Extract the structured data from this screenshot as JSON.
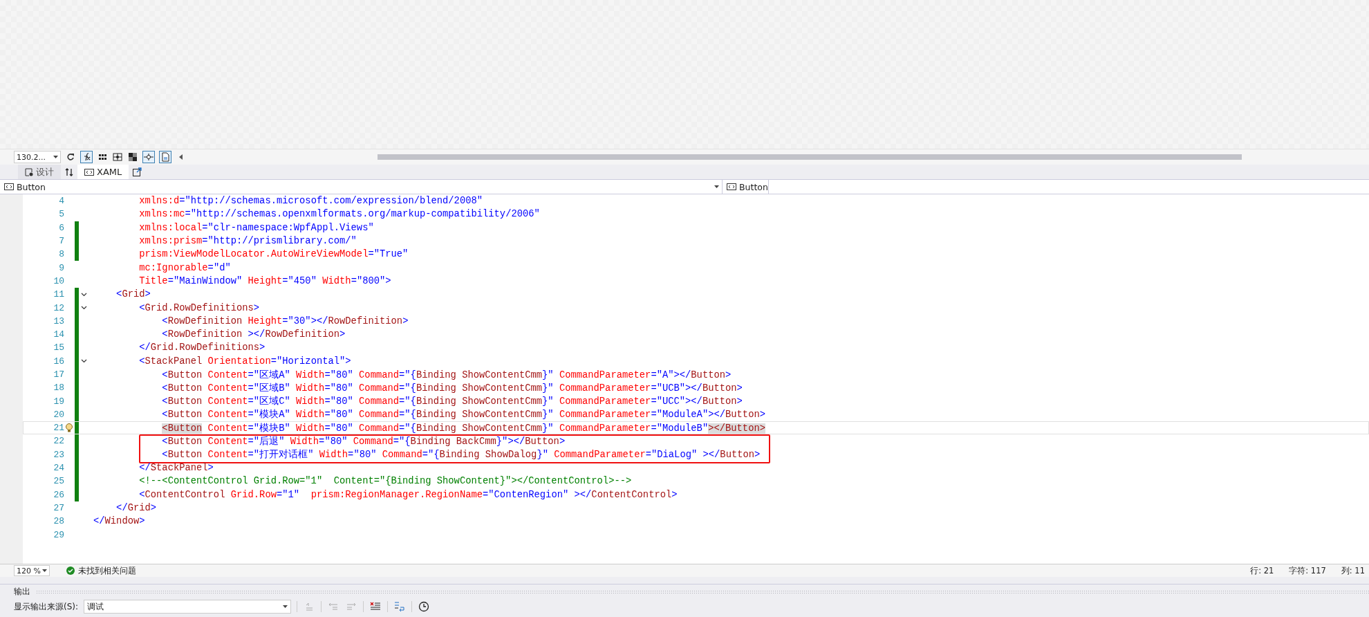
{
  "designer_toolbar": {
    "zoom": "130.2..."
  },
  "tabs": [
    {
      "label": "设计",
      "selected": false
    },
    {
      "label": "XAML",
      "selected": true
    }
  ],
  "nav_bar": {
    "left": "Button",
    "right": "Button"
  },
  "editor": {
    "lines": [
      {
        "number": "4",
        "changed": false,
        "foldable": false,
        "current": false,
        "boxed": false,
        "tokens": [
          {
            "kind": "attr",
            "text": "        xmlns:d"
          },
          {
            "kind": "punct",
            "text": "="
          },
          {
            "kind": "value",
            "text": "\"http://schemas.microsoft.com/expression/blend/2008\""
          }
        ]
      },
      {
        "number": "5",
        "changed": false,
        "foldable": false,
        "current": false,
        "boxed": false,
        "tokens": [
          {
            "kind": "attr",
            "text": "        xmlns:mc"
          },
          {
            "kind": "punct",
            "text": "="
          },
          {
            "kind": "value",
            "text": "\"http://schemas.openxmlformats.org/markup-compatibility/2006\""
          }
        ]
      },
      {
        "number": "6",
        "changed": true,
        "foldable": false,
        "current": false,
        "boxed": false,
        "tokens": [
          {
            "kind": "attr",
            "text": "        xmlns:local"
          },
          {
            "kind": "punct",
            "text": "="
          },
          {
            "kind": "value",
            "text": "\"clr-namespace:WpfAppl.Views\""
          }
        ]
      },
      {
        "number": "7",
        "changed": true,
        "foldable": false,
        "current": false,
        "boxed": false,
        "tokens": [
          {
            "kind": "attr",
            "text": "        xmlns:prism"
          },
          {
            "kind": "punct",
            "text": "="
          },
          {
            "kind": "value",
            "text": "\"http://prismlibrary.com/\""
          }
        ]
      },
      {
        "number": "8",
        "changed": true,
        "foldable": false,
        "current": false,
        "boxed": false,
        "tokens": [
          {
            "kind": "attr",
            "text": "        prism:ViewModelLocator.AutoWireViewModel"
          },
          {
            "kind": "punct",
            "text": "="
          },
          {
            "kind": "value",
            "text": "\"True\""
          }
        ]
      },
      {
        "number": "9",
        "changed": false,
        "foldable": false,
        "current": false,
        "boxed": false,
        "tokens": [
          {
            "kind": "attr",
            "text": "        mc:Ignorable"
          },
          {
            "kind": "punct",
            "text": "="
          },
          {
            "kind": "value",
            "text": "\"d\""
          }
        ]
      },
      {
        "number": "10",
        "changed": false,
        "foldable": false,
        "current": false,
        "boxed": false,
        "tokens": [
          {
            "kind": "attr",
            "text": "        Title"
          },
          {
            "kind": "punct",
            "text": "="
          },
          {
            "kind": "value",
            "text": "\"MainWindow\""
          },
          {
            "kind": "attr",
            "text": " Height"
          },
          {
            "kind": "punct",
            "text": "="
          },
          {
            "kind": "value",
            "text": "\"450\""
          },
          {
            "kind": "attr",
            "text": " Width"
          },
          {
            "kind": "punct",
            "text": "="
          },
          {
            "kind": "value",
            "text": "\"800\""
          },
          {
            "kind": "punct",
            "text": ">"
          }
        ]
      },
      {
        "number": "11",
        "changed": true,
        "foldable": true,
        "current": false,
        "boxed": false,
        "tokens": [
          {
            "kind": "punct",
            "text": "    <"
          },
          {
            "kind": "element",
            "text": "Grid"
          },
          {
            "kind": "punct",
            "text": ">"
          }
        ]
      },
      {
        "number": "12",
        "changed": true,
        "foldable": true,
        "current": false,
        "boxed": false,
        "tokens": [
          {
            "kind": "punct",
            "text": "        <"
          },
          {
            "kind": "element",
            "text": "Grid.RowDefinitions"
          },
          {
            "kind": "punct",
            "text": ">"
          }
        ]
      },
      {
        "number": "13",
        "changed": true,
        "foldable": false,
        "current": false,
        "boxed": false,
        "tokens": [
          {
            "kind": "punct",
            "text": "            <"
          },
          {
            "kind": "element",
            "text": "RowDefinition"
          },
          {
            "kind": "attr",
            "text": " Height"
          },
          {
            "kind": "punct",
            "text": "="
          },
          {
            "kind": "value",
            "text": "\"30\""
          },
          {
            "kind": "punct",
            "text": "></"
          },
          {
            "kind": "element",
            "text": "RowDefinition"
          },
          {
            "kind": "punct",
            "text": ">"
          }
        ]
      },
      {
        "number": "14",
        "changed": true,
        "foldable": false,
        "current": false,
        "boxed": false,
        "tokens": [
          {
            "kind": "punct",
            "text": "            <"
          },
          {
            "kind": "element",
            "text": "RowDefinition"
          },
          {
            "kind": "punct",
            "text": " ></"
          },
          {
            "kind": "element",
            "text": "RowDefinition"
          },
          {
            "kind": "punct",
            "text": ">"
          }
        ]
      },
      {
        "number": "15",
        "changed": true,
        "foldable": false,
        "current": false,
        "boxed": false,
        "tokens": [
          {
            "kind": "punct",
            "text": "        </"
          },
          {
            "kind": "element",
            "text": "Grid.RowDefinitions"
          },
          {
            "kind": "punct",
            "text": ">"
          }
        ]
      },
      {
        "number": "16",
        "changed": true,
        "foldable": true,
        "current": false,
        "boxed": false,
        "tokens": [
          {
            "kind": "punct",
            "text": "        <"
          },
          {
            "kind": "element",
            "text": "StackPanel"
          },
          {
            "kind": "attr",
            "text": " Orientation"
          },
          {
            "kind": "punct",
            "text": "="
          },
          {
            "kind": "value",
            "text": "\"Horizontal\""
          },
          {
            "kind": "punct",
            "text": ">"
          }
        ]
      },
      {
        "number": "17",
        "changed": true,
        "foldable": false,
        "current": false,
        "boxed": false,
        "tokens": [
          {
            "kind": "punct",
            "text": "            <"
          },
          {
            "kind": "element",
            "text": "Button"
          },
          {
            "kind": "attr",
            "text": " Content"
          },
          {
            "kind": "punct",
            "text": "="
          },
          {
            "kind": "value",
            "text": "\"区域A\""
          },
          {
            "kind": "attr",
            "text": " Width"
          },
          {
            "kind": "punct",
            "text": "="
          },
          {
            "kind": "value",
            "text": "\"80\""
          },
          {
            "kind": "attr",
            "text": " Command"
          },
          {
            "kind": "punct",
            "text": "="
          },
          {
            "kind": "value",
            "text": "\"{"
          },
          {
            "kind": "element",
            "text": "Binding ShowContentCmm"
          },
          {
            "kind": "value",
            "text": "}\""
          },
          {
            "kind": "attr",
            "text": " CommandParameter"
          },
          {
            "kind": "punct",
            "text": "="
          },
          {
            "kind": "value",
            "text": "\"A\""
          },
          {
            "kind": "punct",
            "text": "></"
          },
          {
            "kind": "element",
            "text": "Button"
          },
          {
            "kind": "punct",
            "text": ">"
          }
        ]
      },
      {
        "number": "18",
        "changed": true,
        "foldable": false,
        "current": false,
        "boxed": false,
        "tokens": [
          {
            "kind": "punct",
            "text": "            <"
          },
          {
            "kind": "element",
            "text": "Button"
          },
          {
            "kind": "attr",
            "text": " Content"
          },
          {
            "kind": "punct",
            "text": "="
          },
          {
            "kind": "value",
            "text": "\"区域B\""
          },
          {
            "kind": "attr",
            "text": " Width"
          },
          {
            "kind": "punct",
            "text": "="
          },
          {
            "kind": "value",
            "text": "\"80\""
          },
          {
            "kind": "attr",
            "text": " Command"
          },
          {
            "kind": "punct",
            "text": "="
          },
          {
            "kind": "value",
            "text": "\"{"
          },
          {
            "kind": "element",
            "text": "Binding ShowContentCmm"
          },
          {
            "kind": "value",
            "text": "}\""
          },
          {
            "kind": "attr",
            "text": " CommandParameter"
          },
          {
            "kind": "punct",
            "text": "="
          },
          {
            "kind": "value",
            "text": "\"UCB\""
          },
          {
            "kind": "punct",
            "text": "></"
          },
          {
            "kind": "element",
            "text": "Button"
          },
          {
            "kind": "punct",
            "text": ">"
          }
        ]
      },
      {
        "number": "19",
        "changed": true,
        "foldable": false,
        "current": false,
        "boxed": false,
        "tokens": [
          {
            "kind": "punct",
            "text": "            <"
          },
          {
            "kind": "element",
            "text": "Button"
          },
          {
            "kind": "attr",
            "text": " Content"
          },
          {
            "kind": "punct",
            "text": "="
          },
          {
            "kind": "value",
            "text": "\"区域C\""
          },
          {
            "kind": "attr",
            "text": " Width"
          },
          {
            "kind": "punct",
            "text": "="
          },
          {
            "kind": "value",
            "text": "\"80\""
          },
          {
            "kind": "attr",
            "text": " Command"
          },
          {
            "kind": "punct",
            "text": "="
          },
          {
            "kind": "value",
            "text": "\"{"
          },
          {
            "kind": "element",
            "text": "Binding ShowContentCmm"
          },
          {
            "kind": "value",
            "text": "}\""
          },
          {
            "kind": "attr",
            "text": " CommandParameter"
          },
          {
            "kind": "punct",
            "text": "="
          },
          {
            "kind": "value",
            "text": "\"UCC\""
          },
          {
            "kind": "punct",
            "text": "></"
          },
          {
            "kind": "element",
            "text": "Button"
          },
          {
            "kind": "punct",
            "text": ">"
          }
        ]
      },
      {
        "number": "20",
        "changed": true,
        "foldable": false,
        "current": false,
        "boxed": false,
        "tokens": [
          {
            "kind": "punct",
            "text": "            <"
          },
          {
            "kind": "element",
            "text": "Button"
          },
          {
            "kind": "attr",
            "text": " Content"
          },
          {
            "kind": "punct",
            "text": "="
          },
          {
            "kind": "value",
            "text": "\"模块A\""
          },
          {
            "kind": "attr",
            "text": " Width"
          },
          {
            "kind": "punct",
            "text": "="
          },
          {
            "kind": "value",
            "text": "\"80\""
          },
          {
            "kind": "attr",
            "text": " Command"
          },
          {
            "kind": "punct",
            "text": "="
          },
          {
            "kind": "value",
            "text": "\"{"
          },
          {
            "kind": "element",
            "text": "Binding ShowContentCmm"
          },
          {
            "kind": "value",
            "text": "}\""
          },
          {
            "kind": "attr",
            "text": " CommandParameter"
          },
          {
            "kind": "punct",
            "text": "="
          },
          {
            "kind": "value",
            "text": "\"ModuleA\""
          },
          {
            "kind": "punct",
            "text": "></"
          },
          {
            "kind": "element",
            "text": "Button"
          },
          {
            "kind": "punct",
            "text": ">"
          }
        ]
      },
      {
        "number": "21",
        "changed": true,
        "foldable": false,
        "current": true,
        "boxed": false,
        "tokens": [
          {
            "kind": "match",
            "text": "            <Button"
          },
          {
            "kind": "attr",
            "text": " Content"
          },
          {
            "kind": "punct",
            "text": "="
          },
          {
            "kind": "value",
            "text": "\"模块B\""
          },
          {
            "kind": "attr",
            "text": " Width"
          },
          {
            "kind": "punct",
            "text": "="
          },
          {
            "kind": "value",
            "text": "\"80\""
          },
          {
            "kind": "attr",
            "text": " Command"
          },
          {
            "kind": "punct",
            "text": "="
          },
          {
            "kind": "value",
            "text": "\"{"
          },
          {
            "kind": "element",
            "text": "Binding ShowContentCmm"
          },
          {
            "kind": "value",
            "text": "}\""
          },
          {
            "kind": "attr",
            "text": " CommandParameter"
          },
          {
            "kind": "punct",
            "text": "="
          },
          {
            "kind": "value",
            "text": "\"ModuleB\""
          },
          {
            "kind": "match",
            "text": "></Button>"
          }
        ]
      },
      {
        "number": "22",
        "changed": true,
        "foldable": false,
        "current": false,
        "boxed": true,
        "tokens": [
          {
            "kind": "punct",
            "text": "            <"
          },
          {
            "kind": "element",
            "text": "Button"
          },
          {
            "kind": "attr",
            "text": " Content"
          },
          {
            "kind": "punct",
            "text": "="
          },
          {
            "kind": "value",
            "text": "\"后退\""
          },
          {
            "kind": "attr",
            "text": " Width"
          },
          {
            "kind": "punct",
            "text": "="
          },
          {
            "kind": "value",
            "text": "\"80\""
          },
          {
            "kind": "attr",
            "text": " Command"
          },
          {
            "kind": "punct",
            "text": "="
          },
          {
            "kind": "value",
            "text": "\"{"
          },
          {
            "kind": "element",
            "text": "Binding BackCmm"
          },
          {
            "kind": "value",
            "text": "}\""
          },
          {
            "kind": "punct",
            "text": "></"
          },
          {
            "kind": "element",
            "text": "Button"
          },
          {
            "kind": "punct",
            "text": ">"
          }
        ]
      },
      {
        "number": "23",
        "changed": true,
        "foldable": false,
        "current": false,
        "boxed": true,
        "tokens": [
          {
            "kind": "punct",
            "text": "            <"
          },
          {
            "kind": "element",
            "text": "Button"
          },
          {
            "kind": "attr",
            "text": " Content"
          },
          {
            "kind": "punct",
            "text": "="
          },
          {
            "kind": "value",
            "text": "\"打开对话框\""
          },
          {
            "kind": "attr",
            "text": " Width"
          },
          {
            "kind": "punct",
            "text": "="
          },
          {
            "kind": "value",
            "text": "\"80\""
          },
          {
            "kind": "attr",
            "text": " Command"
          },
          {
            "kind": "punct",
            "text": "="
          },
          {
            "kind": "value",
            "text": "\"{"
          },
          {
            "kind": "element",
            "text": "Binding ShowDalog"
          },
          {
            "kind": "value",
            "text": "}\""
          },
          {
            "kind": "attr",
            "text": " CommandParameter"
          },
          {
            "kind": "punct",
            "text": "="
          },
          {
            "kind": "value",
            "text": "\"DiaLog\""
          },
          {
            "kind": "punct",
            "text": " ></"
          },
          {
            "kind": "element",
            "text": "Button"
          },
          {
            "kind": "punct",
            "text": ">"
          }
        ]
      },
      {
        "number": "24",
        "changed": true,
        "foldable": false,
        "current": false,
        "boxed": false,
        "tokens": [
          {
            "kind": "punct",
            "text": "        </"
          },
          {
            "kind": "element",
            "text": "StackPanel"
          },
          {
            "kind": "punct",
            "text": ">"
          }
        ]
      },
      {
        "number": "25",
        "changed": true,
        "foldable": false,
        "current": false,
        "boxed": false,
        "tokens": [
          {
            "kind": "comment",
            "text": "        <!--<ContentControl Grid.Row=\"1\"  Content=\"{Binding ShowContent}\"></ContentControl>-->"
          }
        ]
      },
      {
        "number": "26",
        "changed": true,
        "foldable": false,
        "current": false,
        "boxed": false,
        "tokens": [
          {
            "kind": "punct",
            "text": "        <"
          },
          {
            "kind": "element",
            "text": "ContentControl"
          },
          {
            "kind": "attr",
            "text": " Grid.Row"
          },
          {
            "kind": "punct",
            "text": "="
          },
          {
            "kind": "value",
            "text": "\"1\""
          },
          {
            "kind": "attr",
            "text": "  prism:RegionManager.RegionName"
          },
          {
            "kind": "punct",
            "text": "="
          },
          {
            "kind": "value",
            "text": "\"ContenRegion\""
          },
          {
            "kind": "punct",
            "text": " ></"
          },
          {
            "kind": "element",
            "text": "ContentControl"
          },
          {
            "kind": "punct",
            "text": ">"
          }
        ]
      },
      {
        "number": "27",
        "changed": false,
        "foldable": false,
        "current": false,
        "boxed": false,
        "tokens": [
          {
            "kind": "punct",
            "text": "    </"
          },
          {
            "kind": "element",
            "text": "Grid"
          },
          {
            "kind": "punct",
            "text": ">"
          }
        ]
      },
      {
        "number": "28",
        "changed": false,
        "foldable": false,
        "current": false,
        "boxed": false,
        "tokens": [
          {
            "kind": "punct",
            "text": "</"
          },
          {
            "kind": "element",
            "text": "Window"
          },
          {
            "kind": "punct",
            "text": ">"
          }
        ]
      },
      {
        "number": "29",
        "changed": false,
        "foldable": false,
        "current": false,
        "boxed": false
      }
    ]
  },
  "status_bar": {
    "zoom": "120 %",
    "issues": "未找到相关问题",
    "line": "行: 21",
    "char": "字符: 117",
    "column": "列: 11"
  },
  "output_panel": {
    "title": "输出",
    "source_label": "显示输出来源(S):",
    "source": "调试"
  }
}
